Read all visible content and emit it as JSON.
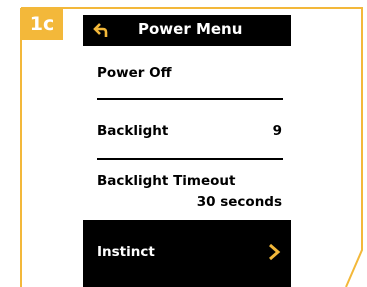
{
  "step_badge": "1c",
  "header": {
    "title": "Power Menu",
    "back_icon": "back-arrow-icon"
  },
  "menu": {
    "power_off": "Power Off",
    "backlight_label": "Backlight",
    "backlight_value": "9",
    "backlight_timeout_label": "Backlight Timeout",
    "backlight_timeout_value": "30 seconds",
    "instinct_label": "Instinct",
    "instinct_icon": "chevron-right-icon"
  },
  "colors": {
    "accent": "#f3b83a",
    "header_bg": "#000000",
    "selected_bg": "#000000",
    "text": "#000000",
    "highlight_text": "#ffffff"
  }
}
